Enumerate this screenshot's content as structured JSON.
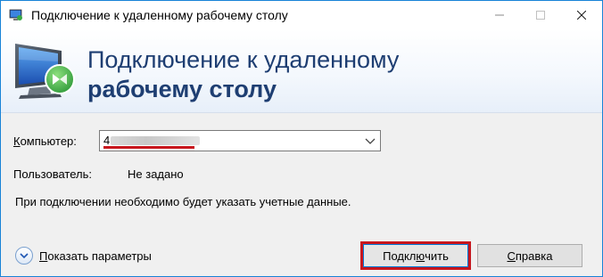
{
  "window": {
    "title": "Подключение к удаленному рабочему столу",
    "icon": "remote-desktop-icon"
  },
  "banner": {
    "line1": "Подключение к удаленному",
    "line2": "рабочему столу"
  },
  "computer": {
    "label": "омпьютер:",
    "label_accel": "К",
    "value": "4"
  },
  "user": {
    "label": "Пользователь:",
    "value": "Не задано"
  },
  "message": "При подключении необходимо будет указать учетные данные.",
  "options": {
    "label_accel": "П",
    "label": "оказать параметры"
  },
  "buttons": {
    "connect_pre": "Подкл",
    "connect_accel": "ю",
    "connect_post": "чить",
    "help_accel": "С",
    "help_post": "правка"
  },
  "colors": {
    "accent_border": "#1883d7",
    "banner_text": "#1e3e72",
    "highlight_red": "#c8161d"
  }
}
